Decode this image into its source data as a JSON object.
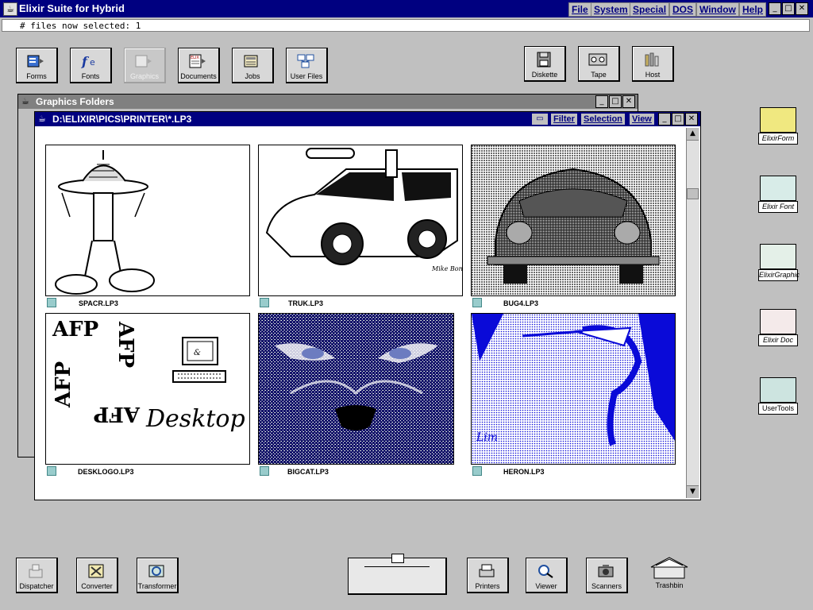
{
  "app": {
    "title": "Elixir Suite for Hybrid",
    "menus": [
      "File",
      "System",
      "Special",
      "DOS",
      "Window",
      "Help"
    ],
    "status": "# files now selected: 1"
  },
  "window_buttons": {
    "minimize": "_",
    "maximize": "□",
    "close": "✕"
  },
  "toolbar_folders": [
    {
      "label": "Forms",
      "icon": "forms-icon"
    },
    {
      "label": "Fonts",
      "icon": "fonts-icon"
    },
    {
      "label": "Graphics",
      "icon": "graphics-icon",
      "dimmed": true
    },
    {
      "label": "Documents",
      "icon": "documents-icon"
    },
    {
      "label": "Jobs",
      "icon": "jobs-icon"
    },
    {
      "label": "User Files",
      "icon": "user-files-icon"
    }
  ],
  "device_folders": [
    {
      "label": "Diskette",
      "icon": "diskette-icon"
    },
    {
      "label": "Tape",
      "icon": "tape-icon"
    },
    {
      "label": "Host",
      "icon": "host-icon"
    }
  ],
  "graphics_folders_window": {
    "title": "Graphics Folders"
  },
  "listing_window": {
    "title": "D:\\ELIXIR\\PICS\\PRINTER\\*.LP3",
    "menus": [
      "Filter",
      "Selection",
      "View"
    ],
    "files": [
      {
        "name": "SPACR.LP3",
        "icon": "lp3-file-icon",
        "thumb": "robot-lamp-drawing"
      },
      {
        "name": "TRUK.LP3",
        "icon": "lp3-file-icon",
        "thumb": "hot-rod-truck-drawing",
        "signature": "Mike Bonnie"
      },
      {
        "name": "BUG4.LP3",
        "icon": "lp3-file-icon",
        "thumb": "vw-beetle-photo"
      },
      {
        "name": "DESKLOGO.LP3",
        "icon": "lp3-file-icon",
        "thumb": "afp-desktop-logo",
        "logo_text": "AFP",
        "logo_word": "Desktop"
      },
      {
        "name": "BIGCAT.LP3",
        "icon": "lp3-file-icon",
        "thumb": "big-cat-face-photo"
      },
      {
        "name": "HERON.LP3",
        "icon": "lp3-file-icon",
        "thumb": "blue-heron-drawing"
      }
    ]
  },
  "right_icons": [
    {
      "label": "ElixirForm",
      "icon": "elixir-form-icon"
    },
    {
      "label": "Elixir Font",
      "icon": "elixir-font-icon"
    },
    {
      "label": "ElixirGraphic",
      "icon": "elixir-graphic-icon"
    },
    {
      "label": "Elixir Doc",
      "icon": "elixir-doc-icon"
    },
    {
      "label": "UserTools",
      "icon": "user-tools-icon"
    }
  ],
  "bottom_icons": [
    {
      "label": "Dispatcher",
      "icon": "dispatcher-icon"
    },
    {
      "label": "Converter",
      "icon": "converter-icon"
    },
    {
      "label": "Transformer",
      "icon": "transformer-icon"
    },
    {
      "label": "Printers",
      "icon": "printers-icon"
    },
    {
      "label": "Viewer",
      "icon": "viewer-icon"
    },
    {
      "label": "Scanners",
      "icon": "scanners-icon"
    },
    {
      "label": "Trashbin",
      "icon": "trashbin-icon"
    }
  ],
  "colors": {
    "titlebar": "#000080",
    "desktop": "#c0c0c0",
    "inactive_title": "#808080",
    "heron_blue": "#0a0ad8",
    "cat_blue": "#14146a"
  }
}
